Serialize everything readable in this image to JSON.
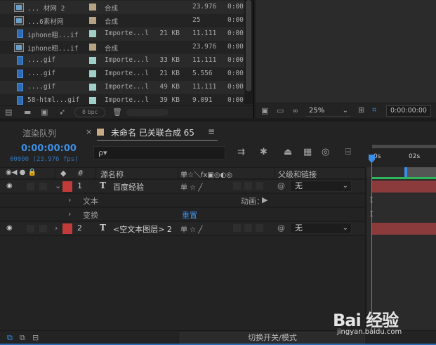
{
  "project": {
    "rows": [
      {
        "icon": "comp",
        "name": "... 材网 2",
        "label_color": "#b5a383",
        "type": "合成",
        "size": "",
        "duration": "23.976",
        "extra": "0:00"
      },
      {
        "icon": "comp",
        "name": "...6素材网",
        "label_color": "#b5a383",
        "type": "合成",
        "size": "",
        "duration": "25",
        "extra": "0:00"
      },
      {
        "icon": "file",
        "name": "iphone粗...if",
        "label_color": "#9fcfc6",
        "type": "Importe...l",
        "size": "21 KB",
        "duration": "11.111",
        "extra": "0:00"
      },
      {
        "icon": "comp",
        "name": "iphone粗...if",
        "label_color": "#b5a383",
        "type": "合成",
        "size": "",
        "duration": "23.976",
        "extra": "0:00"
      },
      {
        "icon": "file",
        "name": "....gif",
        "label_color": "#9fcfc6",
        "type": "Importe...l",
        "size": "33 KB",
        "duration": "11.111",
        "extra": "0:00"
      },
      {
        "icon": "file",
        "name": "....gif",
        "label_color": "#9fcfc6",
        "type": "Importe...l",
        "size": "21 KB",
        "duration": "5.556",
        "extra": "0:00"
      },
      {
        "icon": "file",
        "name": "....gif",
        "label_color": "#9fcfc6",
        "type": "Importe...l",
        "size": "49 KB",
        "duration": "11.111",
        "extra": "0:00"
      },
      {
        "icon": "file",
        "name": "58-html...gif",
        "label_color": "#9fcfc6",
        "type": "Importe...l",
        "size": "39 KB",
        "duration": "9.091",
        "extra": "0:00"
      }
    ],
    "bpc": "8 bpc"
  },
  "viewer": {
    "zoom": "25%",
    "timecode": "0:00:00:00"
  },
  "tabs": {
    "render_queue": "渲染队列",
    "comp_name": "未命名 已关联合成 65",
    "comp_color": "#c9aa84"
  },
  "timeline": {
    "timecode": "0:00:00:00",
    "fps": "00000 (23.976 fps)",
    "search_placeholder": "ρ▾",
    "columns": {
      "hash": "#",
      "source_name": "源名称",
      "switches": "单☆＼fx▣◎◐◎",
      "parent": "父级和链接"
    },
    "ruler": {
      "t0": "0s",
      "t2": "02s"
    },
    "layers": [
      {
        "num": "1",
        "type": "T",
        "name": "百度经验",
        "label_color": "#c23b3b",
        "parent": "无",
        "expanded": true
      },
      {
        "num": "2",
        "type": "T",
        "name": "<空文本图层> 2",
        "label_color": "#c23b3b",
        "parent": "无",
        "expanded": false
      }
    ],
    "props": {
      "text": "文本",
      "transform": "变换",
      "animate": "动画：",
      "reset": "重置"
    },
    "toggle_mode": "切换开关/模式"
  },
  "watermark": {
    "brand": "Bai 经验",
    "url": "jingyan.baidu.com"
  },
  "colors": {
    "accent": "#3b8ee6",
    "layer_bar": "#8b3b3b",
    "green": "#2fb65b"
  }
}
